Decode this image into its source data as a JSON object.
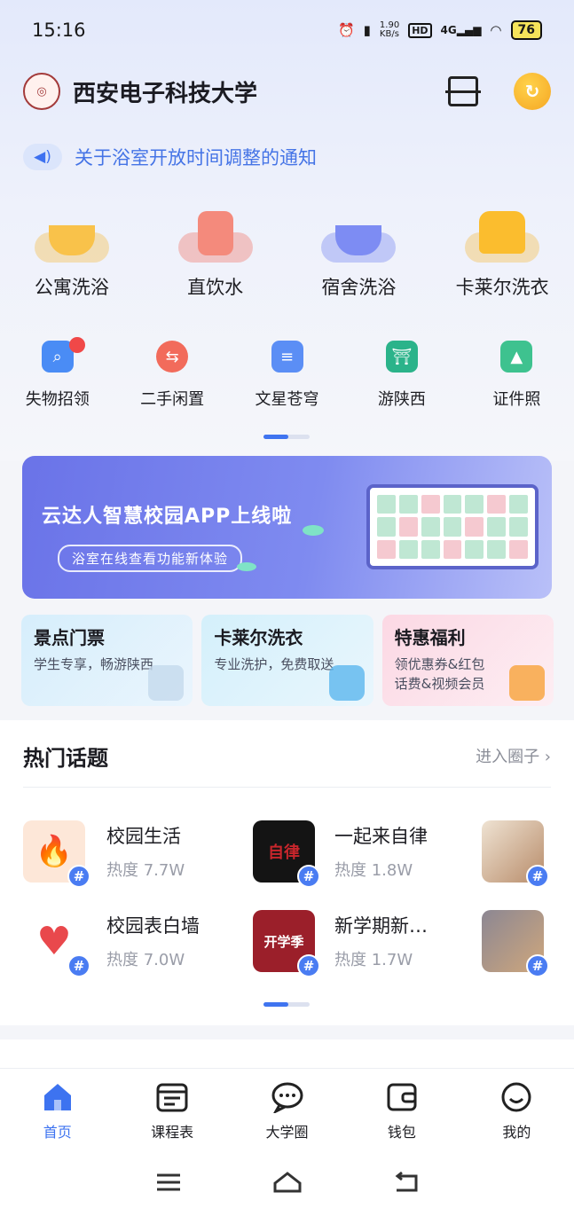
{
  "status_bar": {
    "time": "15:16",
    "speed": "1.90\nKB/s",
    "network": "4G",
    "hd": "HD",
    "battery": "76"
  },
  "header": {
    "school_name": "西安电子科技大学",
    "logo_icon": "university-seal-icon",
    "scan_icon": "scan-icon",
    "coin_icon": "coin-icon"
  },
  "notice": {
    "text": "关于浴室开放时间调整的通知",
    "icon": "speaker-icon"
  },
  "services_main": [
    {
      "label": "公寓洗浴",
      "icon": "bath-icon",
      "color": "#f7b733"
    },
    {
      "label": "直饮水",
      "icon": "water-dispenser-icon",
      "color": "#f26b5b"
    },
    {
      "label": "宿舍洗浴",
      "icon": "shower-icon",
      "color": "#6b7cf0"
    },
    {
      "label": "卡莱尔洗衣",
      "icon": "shirt-icon",
      "color": "#f7b733"
    }
  ],
  "services_small": [
    {
      "label": "失物招领",
      "icon": "lost-found-icon",
      "color": "#4a8cf5",
      "badge": true
    },
    {
      "label": "二手闲置",
      "icon": "exchange-icon",
      "color": "#f26b5b",
      "badge": false
    },
    {
      "label": "文星苍穹",
      "icon": "scroll-icon",
      "color": "#5b8ef5",
      "badge": false
    },
    {
      "label": "游陕西",
      "icon": "pagoda-icon",
      "color": "#2bb38a",
      "badge": false
    },
    {
      "label": "证件照",
      "icon": "photo-icon",
      "color": "#3ec28f",
      "badge": false
    }
  ],
  "banner": {
    "title": "云达人智慧校园APP上线啦",
    "subtitle": "浴室在线查看功能新体验"
  },
  "promos": [
    {
      "title": "景点门票",
      "lines": [
        "学生专享，畅游陕西"
      ],
      "bg": "#dff0fb"
    },
    {
      "title": "卡莱尔洗衣",
      "lines": [
        "专业洗护，免费取送"
      ],
      "bg": "#dff2fb"
    },
    {
      "title": "特惠福利",
      "lines": [
        "领优惠券&红包",
        "话费&视频会员"
      ],
      "bg": "#fde3ec"
    }
  ],
  "topics": {
    "title": "热门话题",
    "more": "进入圈子 ›",
    "items": [
      {
        "name": "校园生活",
        "heat": "热度 7.7W",
        "thumb": "flame-thumbnail",
        "bg": "#fde7d8"
      },
      {
        "name": "一起来自律",
        "heat": "热度 1.8W",
        "thumb": "self-discipline-thumbnail",
        "bg": "#141414"
      },
      {
        "name": "",
        "heat": "",
        "thumb": "breakfast-thumbnail",
        "bg": "#d9c6b2"
      },
      {
        "name": "校园表白墙",
        "heat": "热度 7.0W",
        "thumb": "heart-thumbnail",
        "bg": "#ffffff"
      },
      {
        "name": "新学期新…",
        "heat": "热度 1.7W",
        "thumb": "new-semester-thumbnail",
        "bg": "#9b1f2a"
      },
      {
        "name": "",
        "heat": "",
        "thumb": "runner-thumbnail",
        "bg": "#6e6a72"
      }
    ]
  },
  "tabbar": [
    {
      "label": "首页",
      "icon": "home-icon",
      "active": true
    },
    {
      "label": "课程表",
      "icon": "schedule-icon",
      "active": false
    },
    {
      "label": "大学圈",
      "icon": "chat-icon",
      "active": false
    },
    {
      "label": "钱包",
      "icon": "wallet-icon",
      "active": false
    },
    {
      "label": "我的",
      "icon": "profile-icon",
      "active": false
    }
  ],
  "colors": {
    "accent": "#3d73f0",
    "notice_text": "#4574e6"
  }
}
